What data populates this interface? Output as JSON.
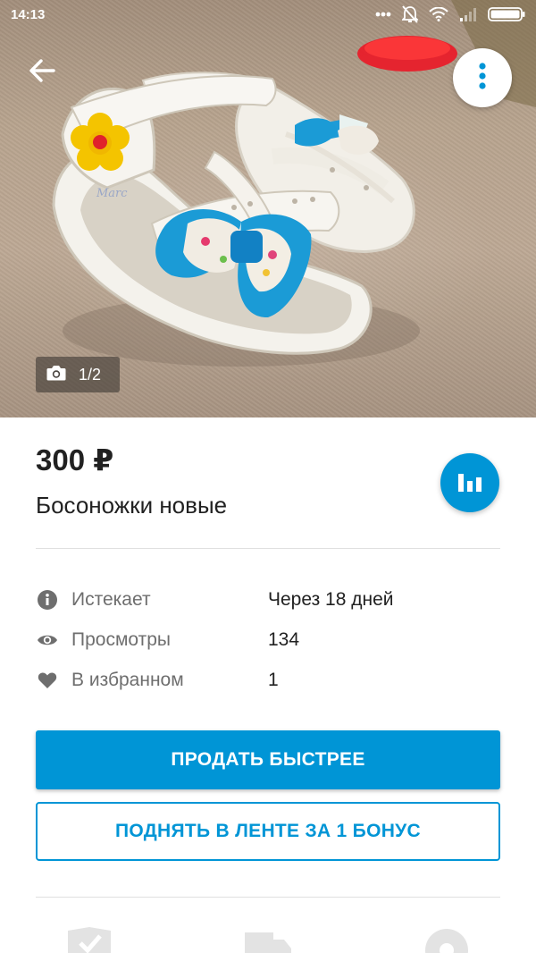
{
  "status_bar": {
    "time": "14:13",
    "icons": [
      "more-dots-icon",
      "notifications-off-icon",
      "wifi-icon",
      "signal-icon",
      "battery-icon"
    ]
  },
  "header": {
    "back_icon": "arrow-back-icon",
    "menu_icon": "more-vertical-icon",
    "photo_counter": {
      "icon": "camera-icon",
      "text": "1/2"
    }
  },
  "listing": {
    "price": "300 ₽",
    "title": "Босоножки новые",
    "stats_icon": "bar-chart-icon"
  },
  "details": [
    {
      "icon": "info-icon",
      "label": "Истекает",
      "value": "Через 18 дней"
    },
    {
      "icon": "eye-icon",
      "label": "Просмотры",
      "value": "134"
    },
    {
      "icon": "heart-icon",
      "label": "В избранном",
      "value": "1"
    }
  ],
  "actions": {
    "sell_faster": "ПРОДАТЬ БЫСТРЕЕ",
    "raise_in_feed": "ПОДНЯТЬ В ЛЕНТЕ ЗА 1 БОНУС"
  },
  "bottom_icons": [
    "verified-check-icon",
    "delivery-truck-icon",
    "settings-badge-icon"
  ],
  "colors": {
    "accent": "#0095d6",
    "text_primary": "#212121",
    "text_secondary": "#6e6e6e",
    "divider": "#e0e0e0"
  }
}
